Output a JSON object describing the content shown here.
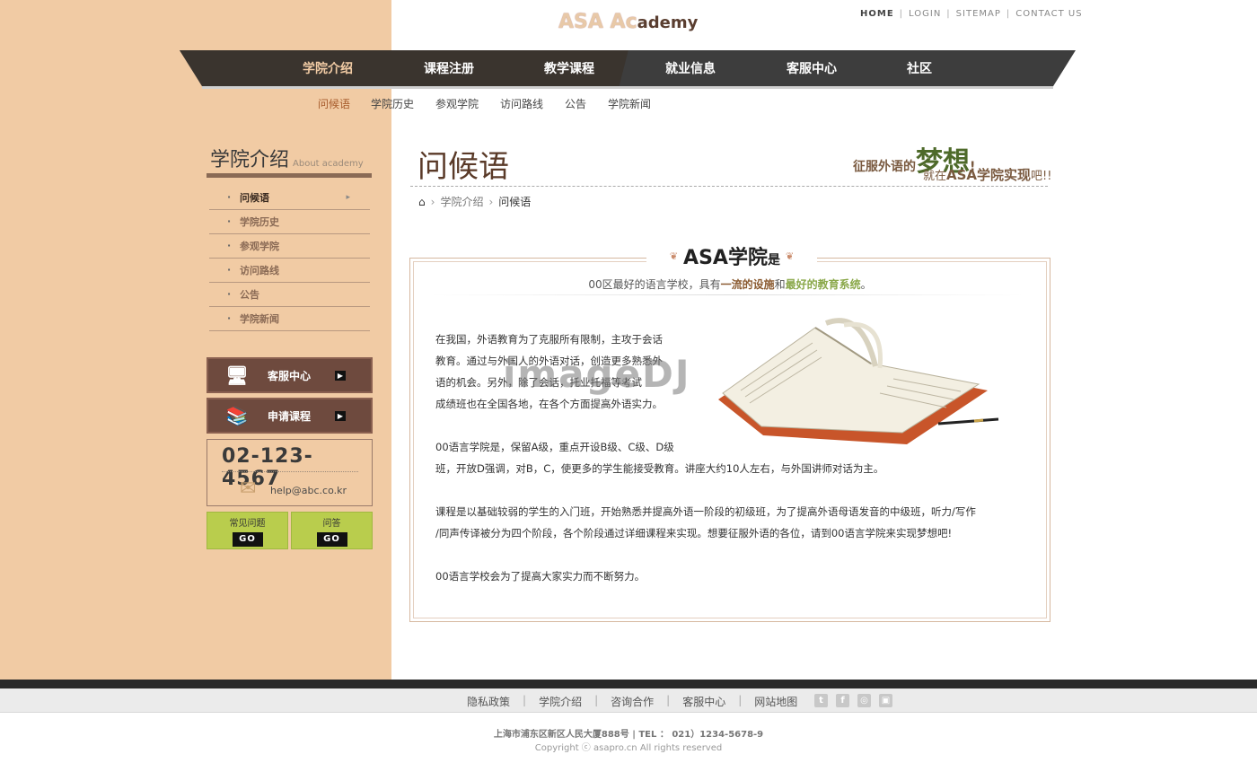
{
  "header": {
    "logo_part1": "ASA Ac",
    "logo_part2": "ademy",
    "top_links": [
      "HOME",
      "LOGIN",
      "SITEMAP",
      "CONTACT US"
    ]
  },
  "gnb": [
    "学院介绍",
    "课程注册",
    "教学课程",
    "就业信息",
    "客服中心",
    "社区"
  ],
  "subnav": [
    "问候语",
    "学院历史",
    "参观学院",
    "访问路线",
    "公告",
    "学院新闻"
  ],
  "sidebar": {
    "title": "学院介绍",
    "title_en": "About academy",
    "items": [
      "问候语",
      "学院历史",
      "参观学院",
      "访问路线",
      "公告",
      "学院新闻"
    ],
    "btn_service": "客服中心",
    "btn_apply": "申请课程",
    "phone": "02-123-4567",
    "email": "help@abc.co.kr",
    "faq": "常见问题",
    "qa": "问答",
    "go": "GO"
  },
  "main": {
    "page_title": "问候语",
    "slogan_a": "征服外语的",
    "slogan_b": "梦想",
    "slogan_c": "!",
    "slogan_d": "就在",
    "slogan_e": "ASA学院实现",
    "slogan_f": "吧!!",
    "breadcrumb_section": "学院介绍",
    "breadcrumb_current": "问候语",
    "box_title": "ASA学院",
    "box_title_suffix": "是",
    "box_sub_1": "00区最好的语言学校，具有",
    "box_sub_2": "一流的设施",
    "box_sub_3": "和",
    "box_sub_4": "最好的教育系统",
    "box_sub_5": "。",
    "p1_l1": "在我国，外语教育为了克服所有限制，主攻于会话",
    "p1_l2": "教育。通过与外国人的外语对话，创造更多熟悉外",
    "p1_l3": "语的机会。另外，除了会话，托业托福等考试",
    "p1_l4": "成绩班也在全国各地，在各个方面提高外语实力。",
    "p2_l1": "00语言学院是，保留A级，重点开设B级、C级、D级",
    "p2_l2": "班，开放D强调，对B，C，使更多的学生能接受教育。讲座大约10人左右，与外国讲师对话为主。",
    "p3_l1": "课程是以基础较弱的学生的入门班，开始熟悉并提高外语一阶段的初级班，为了提高外语母语发音的中级班，听力/写作",
    "p3_l2": "/同声传译被分为四个阶段，各个阶段通过详细课程来实现。想要征服外语的各位，请到00语言学院来实现梦想吧!",
    "p4_l1": "00语言学校会为了提高大家实力而不断努力。",
    "watermark": "imageDJ"
  },
  "footer": {
    "links": [
      "隐私政策",
      "学院介绍",
      "咨询合作",
      "客服中心",
      "网站地图"
    ],
    "address": "上海市浦东区新区人民大厦888号  |  TEL ： 021）1234-5678-9",
    "copyright": "Copyright ⓒ asapro.cn All rights reserved"
  }
}
